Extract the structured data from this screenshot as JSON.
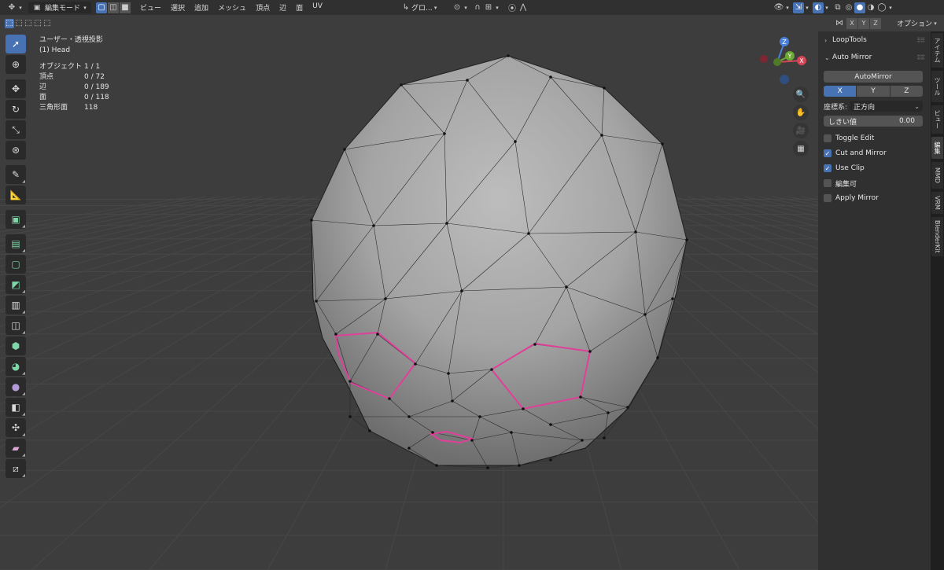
{
  "header": {
    "mode": "編集モード",
    "menus": [
      "ビュー",
      "選択",
      "追加",
      "メッシュ",
      "頂点",
      "辺",
      "面",
      "UV"
    ],
    "transform_orientation": "グロ...",
    "options_label": "オプション"
  },
  "overlay": {
    "view_name": "ユーザー・透視投影",
    "object_name": "(1) Head",
    "stats": [
      {
        "label": "オブジェクト",
        "value": "1 / 1"
      },
      {
        "label": "頂点",
        "value": "0 / 72"
      },
      {
        "label": "辺",
        "value": "0 / 189"
      },
      {
        "label": "面",
        "value": "0 / 118"
      },
      {
        "label": "三角形面",
        "value": "118"
      }
    ]
  },
  "gizmo": {
    "z": "Z",
    "y": "Y",
    "x": "X"
  },
  "xyz_header": [
    "X",
    "Y",
    "Z"
  ],
  "sidebar": {
    "looptools": "LoopTools",
    "automirror_title": "Auto Mirror",
    "automirror_button": "AutoMirror",
    "axes": [
      "X",
      "Y",
      "Z"
    ],
    "active_axis": "X",
    "coord_label": "座標系:",
    "coord_value": "正方向",
    "threshold_label": "しきい値",
    "threshold_value": "0.00",
    "checkboxes": [
      {
        "label": "Toggle Edit",
        "checked": false
      },
      {
        "label": "Cut and Mirror",
        "checked": true
      },
      {
        "label": "Use Clip",
        "checked": true
      },
      {
        "label": "編集可",
        "checked": false
      },
      {
        "label": "Apply Mirror",
        "checked": false
      }
    ]
  },
  "tabs": [
    "アイテム",
    "ツール",
    "ビュー",
    "編集",
    "MMD",
    "VRM",
    "BlenderKit"
  ],
  "colors": {
    "accent": "#4772b3",
    "seam": "#e0409a",
    "viewport_bg": "#3d3d3d"
  }
}
